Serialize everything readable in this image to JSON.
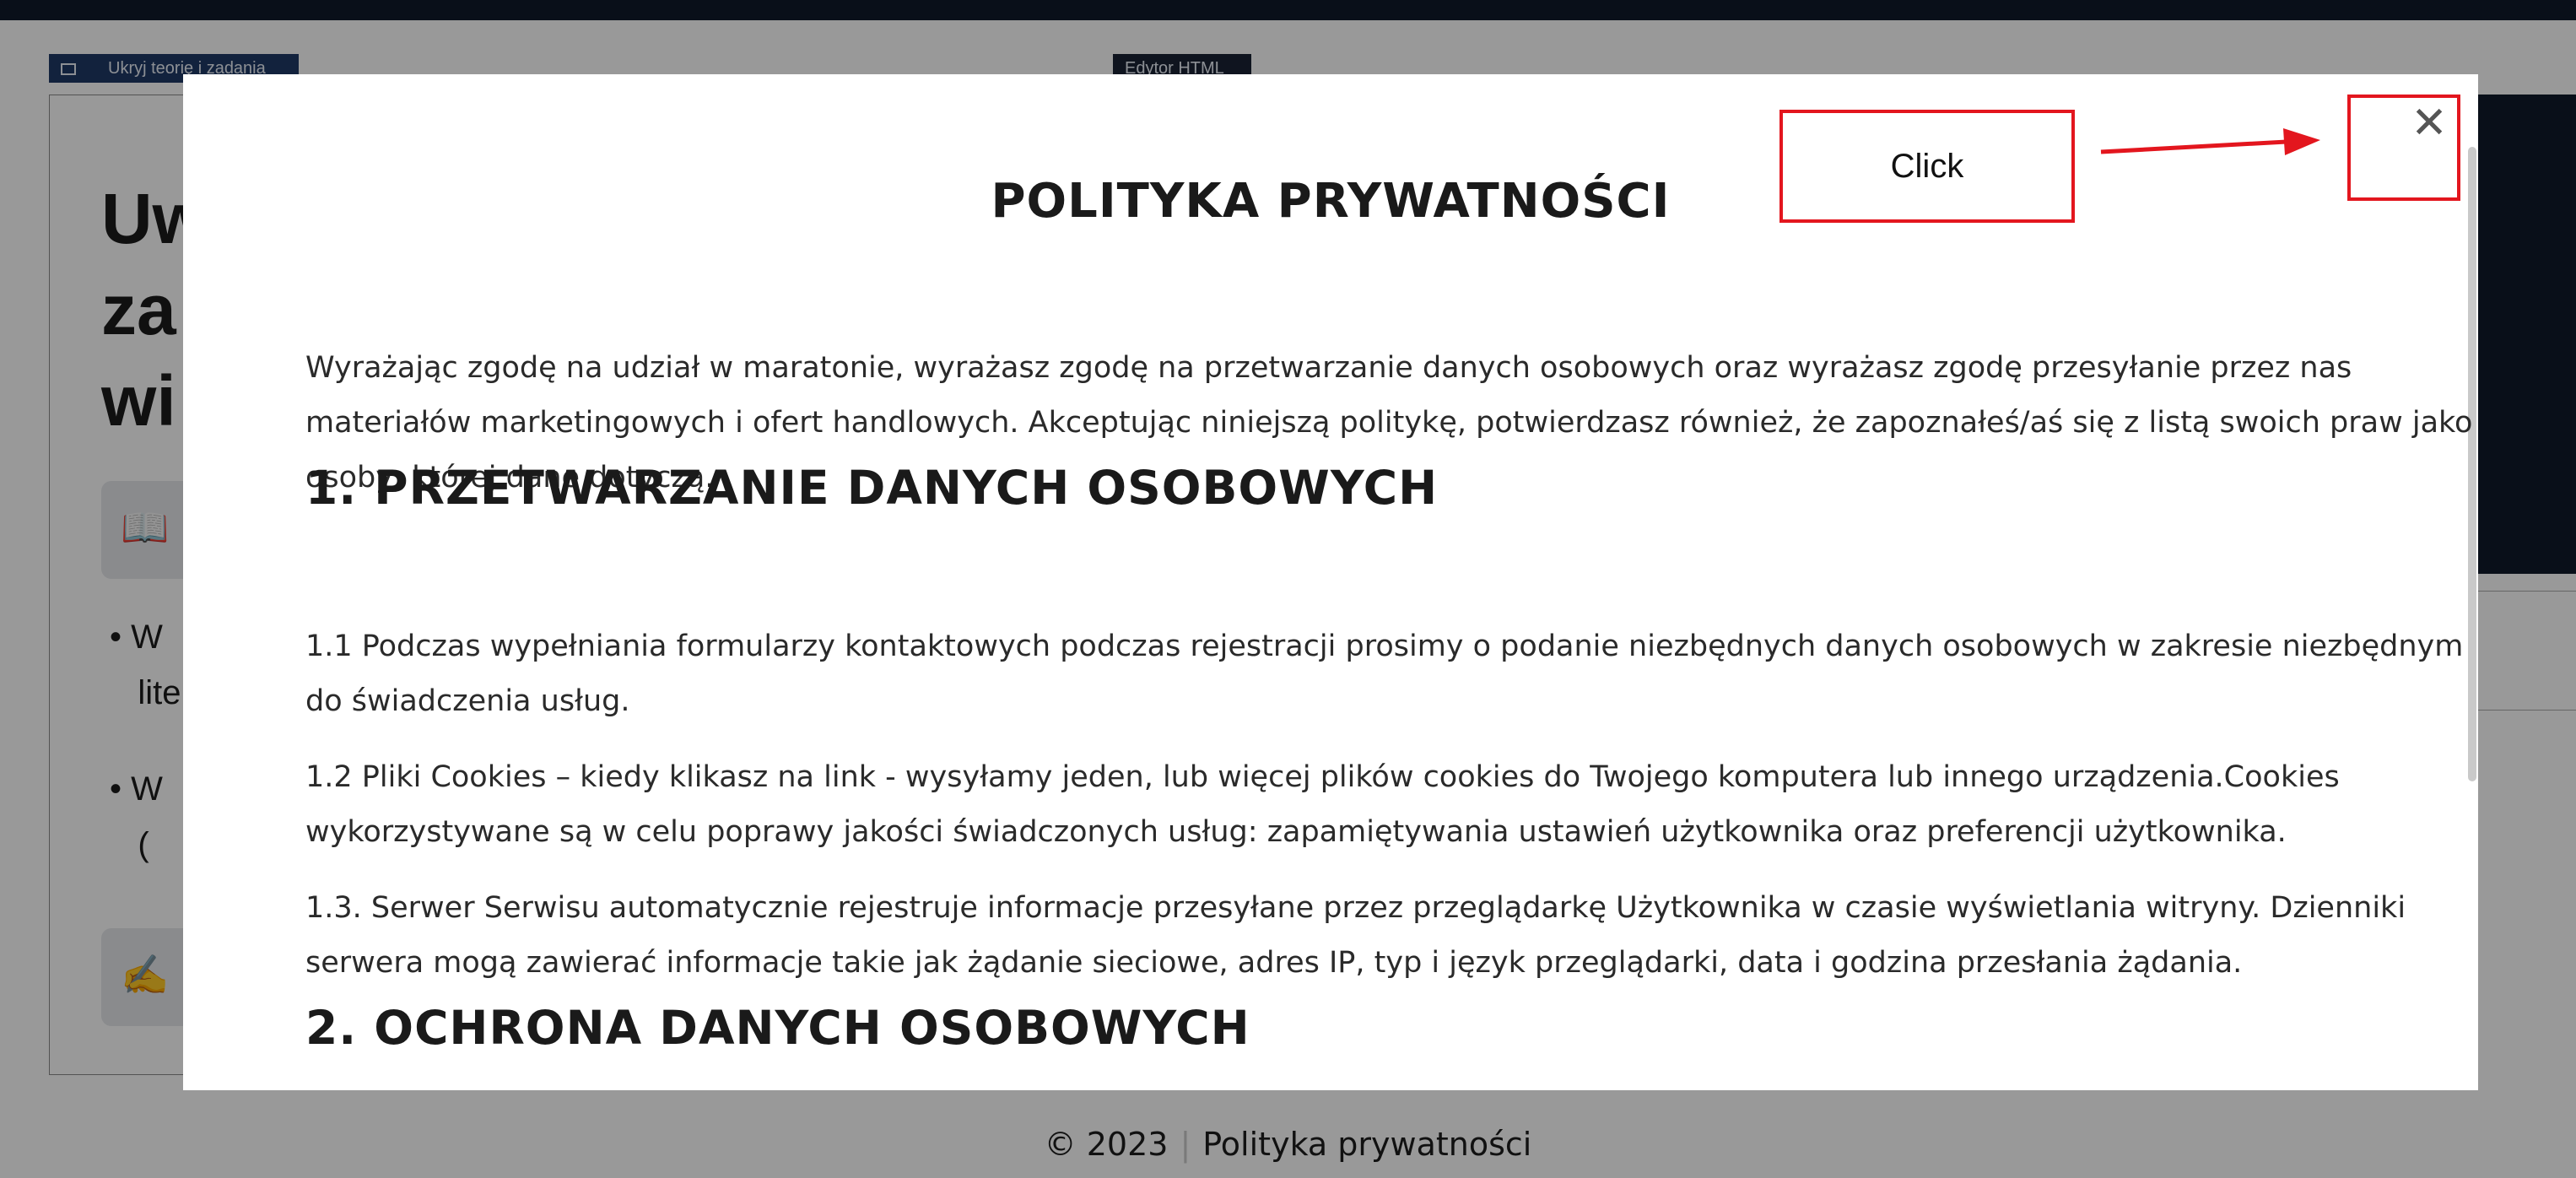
{
  "background": {
    "hide_theory_label": "Ukryj teorię i zadania",
    "html_editor_label": "Edytor HTML",
    "title_partial": "Uw\nza\nwi",
    "bullet1_partial": "• W\n   lite",
    "bullet2_partial": "• W\n   (",
    "book_emoji": "📖",
    "writing_emoji": "✍️"
  },
  "modal": {
    "close_glyph": "✕",
    "title": "POLITYKA PRYWATNOŚCI",
    "intro": "Wyrażając zgodę na udział w maratonie, wyrażasz zgodę na przetwarzanie danych osobowych oraz wyrażasz zgodę przesyłanie przez nas materiałów marketingowych i ofert handlowych. Akceptując niniejszą politykę, potwierdzasz również, że zapoznałeś/aś się z listą swoich praw jako osoby, której dane dotyczą.",
    "section1_heading": "1. PRZETWARZANIE DANYCH OSOBOWYCH",
    "p1_1": "1.1 Podczas wypełniania formularzy kontaktowych podczas rejestracji prosimy o podanie niezbędnych danych osobowych w zakresie niezbędnym do świadczenia usług.",
    "p1_2": "1.2 Pliki Cookies – kiedy klikasz na link - wysyłamy jeden, lub więcej plików cookies do Twojego komputera lub innego urządzenia.Cookies wykorzystywane są w celu poprawy jakości świadczonych usług: zapamiętywania ustawień użytkownika oraz preferencji użytkownika.",
    "p1_3": "1.3. Serwer Serwisu automatycznie rejestruje informacje przesyłane przez przeglądarkę Użytkownika w czasie wyświetlania witryny. Dzienniki serwera mogą zawierać informacje takie jak żądanie sieciowe, adres IP, typ i język przeglądarki, data i godzina przesłania żądania.",
    "section2_heading": "2. OCHRONA DANYCH OSOBOWYCH"
  },
  "annotation": {
    "label": "Click",
    "color": "#e3161e"
  },
  "footer": {
    "copyright": "© 2023",
    "separator": "|",
    "privacy_link": "Polityka prywatności"
  }
}
